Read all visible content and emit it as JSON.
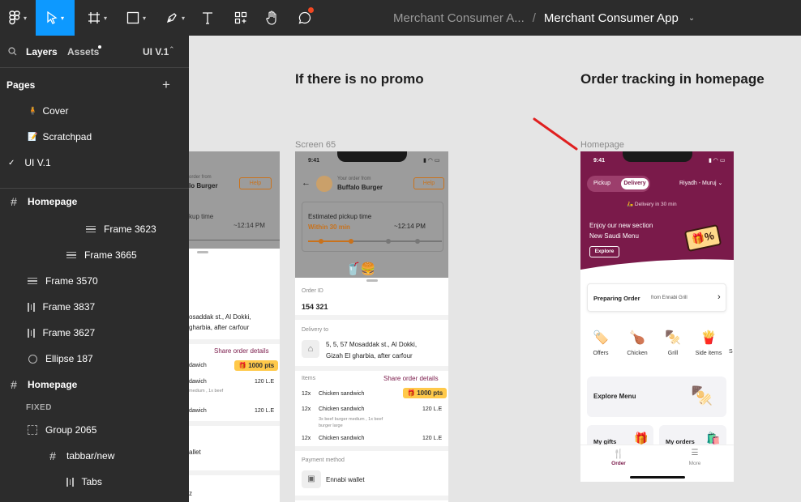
{
  "app": {
    "file_title_dim": "Merchant Consumer A...",
    "file_title": "Merchant Consumer App"
  },
  "sidebar": {
    "tab_layers": "Layers",
    "tab_assets": "Assets",
    "page_selector": "UI V.1",
    "pages_title": "Pages",
    "pages": [
      {
        "label": "Cover",
        "icon": "emoji-person-icon"
      },
      {
        "label": "Scratchpad",
        "icon": "note-icon"
      },
      {
        "label": "UI V.1",
        "icon": "check-icon"
      }
    ],
    "layers": [
      {
        "label": "Homepage"
      },
      {
        "label": "Frame 3623"
      },
      {
        "label": "Frame 3665"
      },
      {
        "label": "Frame 3570"
      },
      {
        "label": "Frame 3837"
      },
      {
        "label": "Frame 3627"
      },
      {
        "label": "Ellipse 187"
      },
      {
        "label": "Homepage"
      },
      {
        "label": "FIXED"
      },
      {
        "label": "Group 2065"
      },
      {
        "label": "tabbar/new"
      },
      {
        "label": "Tabs"
      }
    ]
  },
  "canvas": {
    "heading_no_promo": "If there is no promo",
    "heading_tracking": "Order tracking in homepage",
    "label_screen65": "Screen 65",
    "label_homepage": "Homepage",
    "annotation_color": "#e02020"
  },
  "left_partial": {
    "order_from_small": "order from",
    "restaurant": "lo Burger",
    "help": "Help",
    "pickup_time": "kup time",
    "time_value": "~12:14 PM",
    "address1": "osaddak st., Al Dokki,",
    "address2": "gharbia, after carfour",
    "share": "Share order details",
    "item1": "dawich",
    "pts": "1000 pts",
    "item1_note": "medium , 1x beef",
    "price1": "120 L.E",
    "item2": "dawich",
    "price2": "120 L.E",
    "wallet": "allet",
    "z": "z"
  },
  "screen65": {
    "time": "9:41",
    "your_order_from": "Your order from",
    "restaurant": "Buffalo Burger",
    "help": "Help",
    "estimated": "Estimated pickup time",
    "within": "Within 30 min",
    "eta": "~12:14 PM",
    "order_id_label": "Order ID",
    "order_id": "154 321",
    "delivery_to": "Delivery to",
    "address1": "5, 5, 57 Mosaddak st., Al Dokki,",
    "address2": "Gizah El gharbia, after carfour",
    "items_label": "Items",
    "share": "Share order details",
    "items": [
      {
        "qty": "12x",
        "name": "Chicken sandwich",
        "extra": "1000 pts"
      },
      {
        "qty": "12x",
        "name": "Chicken sandwich",
        "price": "120 L.E",
        "note1": "3x beef burger medium , 1x beef",
        "note2": "burger large"
      },
      {
        "qty": "12x",
        "name": "Chicken sandwich",
        "price": "120 L.E"
      }
    ],
    "payment_label": "Payment method",
    "payment": "Ennabi wallet"
  },
  "homepage": {
    "time": "9:41",
    "pickup": "Pickup",
    "delivery": "Delivery",
    "location": "Riyadh - Muruj",
    "delivery_in": "Delivery in 30 min",
    "promo1": "Enjoy our new section",
    "promo2": "New Saudi Menu",
    "explore": "Explore",
    "preparing": "Preparing Order",
    "preparing_from": "from Ennabi Grill",
    "categories": [
      "Offers",
      "Chicken",
      "Grill",
      "Side items",
      "S"
    ],
    "explore_menu": "Explore Menu",
    "my_gifts": "My gifts",
    "my_orders": "My orders",
    "tab_order": "Order",
    "tab_more": "More",
    "brand_color": "#7a1a4a"
  }
}
